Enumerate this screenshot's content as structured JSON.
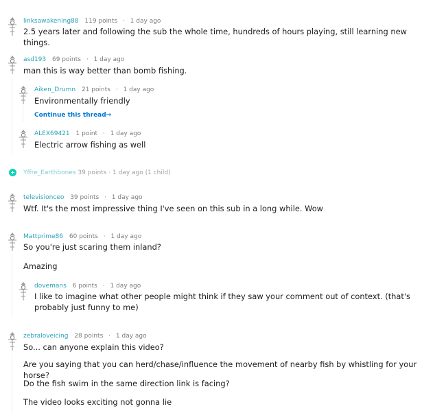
{
  "comments": [
    {
      "user": "linksawakening88",
      "points": "119 points",
      "time": "1 day ago",
      "text": "2.5 years later and following the sub the whole time, hundreds of hours playing, still learning new things."
    },
    {
      "user": "asd193",
      "points": "69 points",
      "time": "1 day ago",
      "text": "man this is way better than bomb fishing."
    },
    {
      "user": "Aiken_Drumn",
      "points": "21 points",
      "time": "1 day ago",
      "text": "Environmentally friendly",
      "continue_link": "Continue this thread→"
    },
    {
      "user": "ALEX69421",
      "points": "1 point",
      "time": "1 day ago",
      "text": "Electric arrow fishing as well"
    },
    {
      "user": "Yffre_Earthbones",
      "points": "39 points",
      "time": "1 day ago",
      "children": "(1 child)"
    },
    {
      "user": "televisionceo",
      "points": "39 points",
      "time": "1 day ago",
      "text": "Wtf. It's the most impressive thing I've seen on this sub in a long while. Wow"
    },
    {
      "user": "Mattprime86",
      "points": "60 points",
      "time": "1 day ago",
      "text": "So you're just scaring them inland?",
      "text2": "Amazing"
    },
    {
      "user": "dovemans",
      "points": "6 points",
      "time": "1 day ago",
      "text": "I like to imagine what other people might think if they saw your comment out of context. (that's probably just funny to me)"
    },
    {
      "user": "zebraloveicing",
      "points": "28 points",
      "time": "1 day ago",
      "paragraphs": [
        "So... can anyone explain this video?",
        "Are you saying that you can herd/chase/influence the movement of nearby fish by whistling for your horse?",
        "Do the fish swim in the same direction link is facing?",
        "The video looks exciting not gonna lie"
      ]
    }
  ]
}
